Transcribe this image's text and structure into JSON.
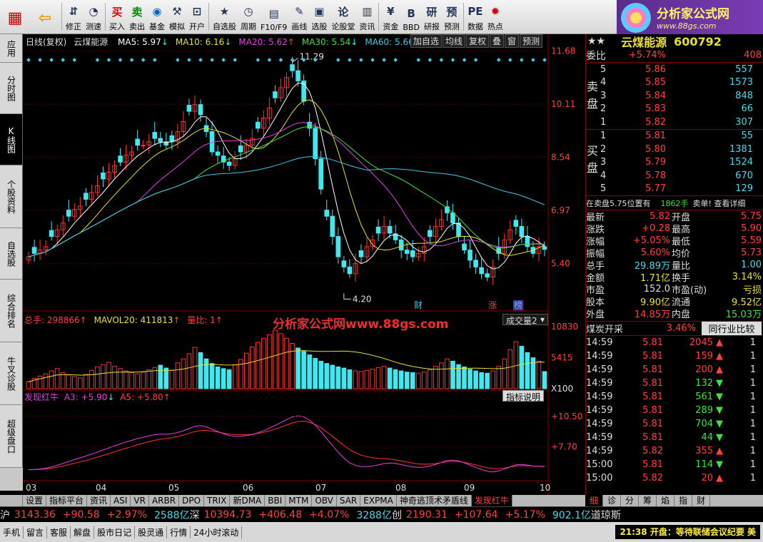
{
  "toolbar": {
    "items": [
      {
        "label": "",
        "icon": "grid-icon"
      },
      {
        "label": "",
        "icon": "back-arrow-icon"
      },
      {
        "label": "修正",
        "icon": "up-down-icon"
      },
      {
        "label": "测速",
        "icon": "speed-icon"
      },
      {
        "label": "买入",
        "icon": "buy-icon"
      },
      {
        "label": "卖出",
        "icon": "sell-icon"
      },
      {
        "label": "基金",
        "icon": "fund-icon"
      },
      {
        "label": "模拟",
        "icon": "hammer-icon"
      },
      {
        "label": "开户",
        "icon": "lock-icon"
      },
      {
        "label": "自选股",
        "icon": "star-icon"
      },
      {
        "label": "周期",
        "icon": "clock-icon"
      },
      {
        "label": "F10/F9",
        "icon": "chart-icon"
      },
      {
        "label": "画线",
        "icon": "pen-icon"
      },
      {
        "label": "选股",
        "icon": "screen-icon"
      },
      {
        "label": "论股堂",
        "icon": "discuss-icon"
      },
      {
        "label": "资讯",
        "icon": "news-icon"
      },
      {
        "label": "资金",
        "icon": "money-icon"
      },
      {
        "label": "BBD",
        "icon": "bbd-icon"
      },
      {
        "label": "研报",
        "icon": "report-icon"
      },
      {
        "label": "预测",
        "icon": "forecast-icon"
      },
      {
        "label": "数据",
        "icon": "pe-icon"
      },
      {
        "label": "热点",
        "icon": "fire-icon"
      }
    ]
  },
  "brand": {
    "title": "分析家公式网",
    "url": "www.88gs.com"
  },
  "side_tabs": [
    "应用",
    "分时图",
    "K线图",
    "个股资料",
    "自选股",
    "综合排名",
    "牛叉诊股",
    "超级盘口"
  ],
  "chart": {
    "title": "日线(复权)",
    "stock": "云煤能源",
    "ma": [
      {
        "label": "MA5: 5.97",
        "color": "#ffffff"
      },
      {
        "label": "MA10: 6.16",
        "color": "#e8e030"
      },
      {
        "label": "MA20: 5.62",
        "color": "#e040e0"
      },
      {
        "label": "MA30: 5.54",
        "color": "#40e040"
      },
      {
        "label": "MA60: 5.66",
        "color": "#40c8e8"
      }
    ],
    "buttons": [
      "加自选",
      "均线",
      "复权",
      "叠",
      "窗",
      "预测"
    ],
    "price_axis": [
      "11.68",
      "10.11",
      "8.54",
      "6.97",
      "5.40"
    ],
    "high_label": "11.29",
    "low_label": "4.20",
    "markers": [
      "财",
      "涨",
      "榜"
    ],
    "volume_title": "总手: 298866",
    "mavol": "MAVOL20: 411813",
    "liangbi": "量比: 1",
    "volume_select": "成交量2",
    "volume_axis": [
      "10830",
      "5415",
      "X100"
    ],
    "indicator_title": "发现红牛",
    "a3": "A3: +5.90",
    "a5": "A5: +5.80",
    "indicator_button": "指标说明",
    "indicator_axis": [
      "+10.50",
      "+7.70"
    ],
    "months": [
      "03",
      "04",
      "05",
      "06",
      "07",
      "08",
      "09",
      "10"
    ],
    "watermark": "分析家公式网www.88gs.com"
  },
  "quote": {
    "name": "云煤能源",
    "code": "600792",
    "weibi_label": "委比",
    "weibi": "+5.74%",
    "weicha": "408",
    "sell_word": "卖盘",
    "buy_word": "买盘",
    "sells": [
      {
        "n": "5",
        "price": "5.86",
        "vol": "557"
      },
      {
        "n": "4",
        "price": "5.85",
        "vol": "1573"
      },
      {
        "n": "3",
        "price": "5.84",
        "vol": "848"
      },
      {
        "n": "2",
        "price": "5.83",
        "vol": "66"
      },
      {
        "n": "1",
        "price": "5.82",
        "vol": "307"
      }
    ],
    "buys": [
      {
        "n": "1",
        "price": "5.81",
        "vol": "55"
      },
      {
        "n": "2",
        "price": "5.80",
        "vol": "1381"
      },
      {
        "n": "3",
        "price": "5.79",
        "vol": "1524"
      },
      {
        "n": "4",
        "price": "5.78",
        "vol": "670"
      },
      {
        "n": "5",
        "price": "5.77",
        "vol": "129"
      }
    ],
    "notice": "在卖盘5.75位置有",
    "notice_vol": "1862手",
    "notice_tail": "卖单! 查看详细",
    "stats": [
      {
        "l": "最新",
        "v": "5.82",
        "l2": "开盘",
        "v2": "5.75"
      },
      {
        "l": "涨跌",
        "v": "+0.28",
        "l2": "最高",
        "v2": "5.90"
      },
      {
        "l": "涨幅",
        "v": "+5.05%",
        "l2": "最低",
        "v2": "5.59"
      },
      {
        "l": "振幅",
        "v": "5.60%",
        "l2": "均价",
        "v2": "5.73"
      },
      {
        "l": "总手",
        "v": "29.89万",
        "l2": "量比",
        "v2": "1.00"
      },
      {
        "l": "金额",
        "v": "1.71亿",
        "l2": "换手",
        "v2": "3.14%"
      },
      {
        "l": "市盈",
        "v": "152.0",
        "l2": "市盈(动)",
        "v2": "亏损"
      },
      {
        "l": "股本",
        "v": "9.90亿",
        "l2": "流通",
        "v2": "9.52亿"
      },
      {
        "l": "外盘",
        "v": "14.85万",
        "l2": "内盘",
        "v2": "15.03万"
      }
    ],
    "sector": "煤炭开采",
    "sector_pct": "3.46%",
    "sector_btn": "同行业比较",
    "ticks": [
      {
        "t": "14:59",
        "p": "5.81",
        "v": "2045",
        "d": "up",
        "n": "1"
      },
      {
        "t": "14:59",
        "p": "5.81",
        "v": "159",
        "d": "up",
        "n": "1"
      },
      {
        "t": "14:59",
        "p": "5.81",
        "v": "200",
        "d": "up",
        "n": "1"
      },
      {
        "t": "14:59",
        "p": "5.81",
        "v": "132",
        "d": "down",
        "n": "1"
      },
      {
        "t": "14:59",
        "p": "5.81",
        "v": "561",
        "d": "down",
        "n": "1"
      },
      {
        "t": "14:59",
        "p": "5.81",
        "v": "289",
        "d": "down",
        "n": "1"
      },
      {
        "t": "14:59",
        "p": "5.81",
        "v": "704",
        "d": "down",
        "n": "1"
      },
      {
        "t": "14:59",
        "p": "5.81",
        "v": "44",
        "d": "down",
        "n": "1"
      },
      {
        "t": "14:59",
        "p": "5.82",
        "v": "355",
        "d": "up",
        "n": "1"
      },
      {
        "t": "15:00",
        "p": "5.81",
        "v": "114",
        "d": "down",
        "n": "1"
      },
      {
        "t": "15:00",
        "p": "5.82",
        "v": "20",
        "d": "up",
        "n": "1"
      }
    ]
  },
  "bottom_tabs": [
    "设置",
    "指标平台",
    "资讯",
    "ASI",
    "VR",
    "ARBR",
    "DPO",
    "TRIX",
    "新DMA",
    "BBI",
    "MTM",
    "OBV",
    "SAR",
    "EXPMA",
    "神奇逃顶术矛盾线",
    "发现红牛"
  ],
  "right_tabs": [
    "细",
    "诊",
    "分",
    "筹",
    "焰",
    "指",
    "财"
  ],
  "indexbar": {
    "sh_label": "沪",
    "sh_val": "3143.36",
    "sh_chg": "+90.58",
    "sh_pct": "+2.97%",
    "sh_amt": "2588亿",
    "sz_label": "深",
    "sz_val": "10394.73",
    "sz_chg": "+406.48",
    "sz_pct": "+4.07%",
    "sz_amt": "3288亿",
    "cy_label": "创",
    "cy_val": "2190.31",
    "cy_chg": "+107.64",
    "cy_pct": "+5.17%",
    "cy_amt": "902.1亿",
    "dj_label": "道琼斯"
  },
  "statusbar": {
    "items": [
      "手机",
      "留言",
      "客服",
      "解盘",
      "股市日记",
      "股灵通",
      "行情",
      "24小时滚动"
    ],
    "news": "21:38 开盘：等待联储会议纪要 美"
  },
  "colors": {
    "up": "#ff3030",
    "down": "#40e8f0",
    "bg": "#000000",
    "accent": "#e8e030"
  },
  "chart_data": {
    "type": "candlestick",
    "title": "日线(复权)",
    "ylim": [
      4.0,
      11.8
    ],
    "x_months": [
      "03",
      "04",
      "05",
      "06",
      "07",
      "08",
      "09",
      "10"
    ],
    "close": [
      5.6,
      5.7,
      5.8,
      5.9,
      6.2,
      6.4,
      6.6,
      6.8,
      7.0,
      7.1,
      7.3,
      7.5,
      7.7,
      7.9,
      8.1,
      8.3,
      8.4,
      8.6,
      8.7,
      8.9,
      8.9,
      9.0,
      9.1,
      9.0,
      8.9,
      9.0,
      9.3,
      9.6,
      9.9,
      10.1,
      9.8,
      9.3,
      8.7,
      8.6,
      8.4,
      8.3,
      8.5,
      8.7,
      8.9,
      9.1,
      9.4,
      9.7,
      10.0,
      10.3,
      10.6,
      10.9,
      11.1,
      10.8,
      10.2,
      9.4,
      8.5,
      7.6,
      6.8,
      6.2,
      5.6,
      5.3,
      5.1,
      5.4,
      5.6,
      5.9,
      6.1,
      6.3,
      6.5,
      6.3,
      6.1,
      5.8,
      5.7,
      5.6,
      5.7,
      5.9,
      6.2,
      6.5,
      6.7,
      6.9,
      6.6,
      6.2,
      5.8,
      5.5,
      5.3,
      5.1,
      5.0,
      5.3,
      5.7,
      6.1,
      6.4,
      6.5,
      6.2,
      5.9,
      5.7,
      5.9,
      5.82
    ],
    "volume": [
      1200,
      1800,
      2200,
      2600,
      3100,
      3500,
      2800,
      2400,
      2100,
      1900,
      2500,
      3200,
      3800,
      4200,
      4600,
      3900,
      3500,
      3100,
      2800,
      2600,
      2900,
      3300,
      3700,
      4100,
      3600,
      3200,
      4500,
      5200,
      6100,
      7200,
      6300,
      5200,
      4400,
      3800,
      3500,
      3300,
      4200,
      5100,
      6200,
      7300,
      8100,
      8800,
      9400,
      10200,
      9600,
      8800,
      7900,
      7100,
      6500,
      5900,
      5300,
      4800,
      4400,
      4100,
      3800,
      3600,
      3300,
      3100,
      3000,
      3200,
      3400,
      3700,
      3900,
      3600,
      3300,
      3100,
      2900,
      2800,
      2700,
      2900,
      3300,
      3900,
      4500,
      5200,
      4800,
      4200,
      3800,
      3400,
      3100,
      2800,
      2700,
      3100,
      3900,
      5200,
      6800,
      8200,
      7400,
      6300,
      5400,
      4800,
      2988
    ],
    "series": [
      {
        "name": "MA5",
        "value_last": 5.97
      },
      {
        "name": "MA10",
        "value_last": 6.16
      },
      {
        "name": "MA20",
        "value_last": 5.62
      },
      {
        "name": "MA30",
        "value_last": 5.54
      },
      {
        "name": "MA60",
        "value_last": 5.66
      }
    ]
  }
}
